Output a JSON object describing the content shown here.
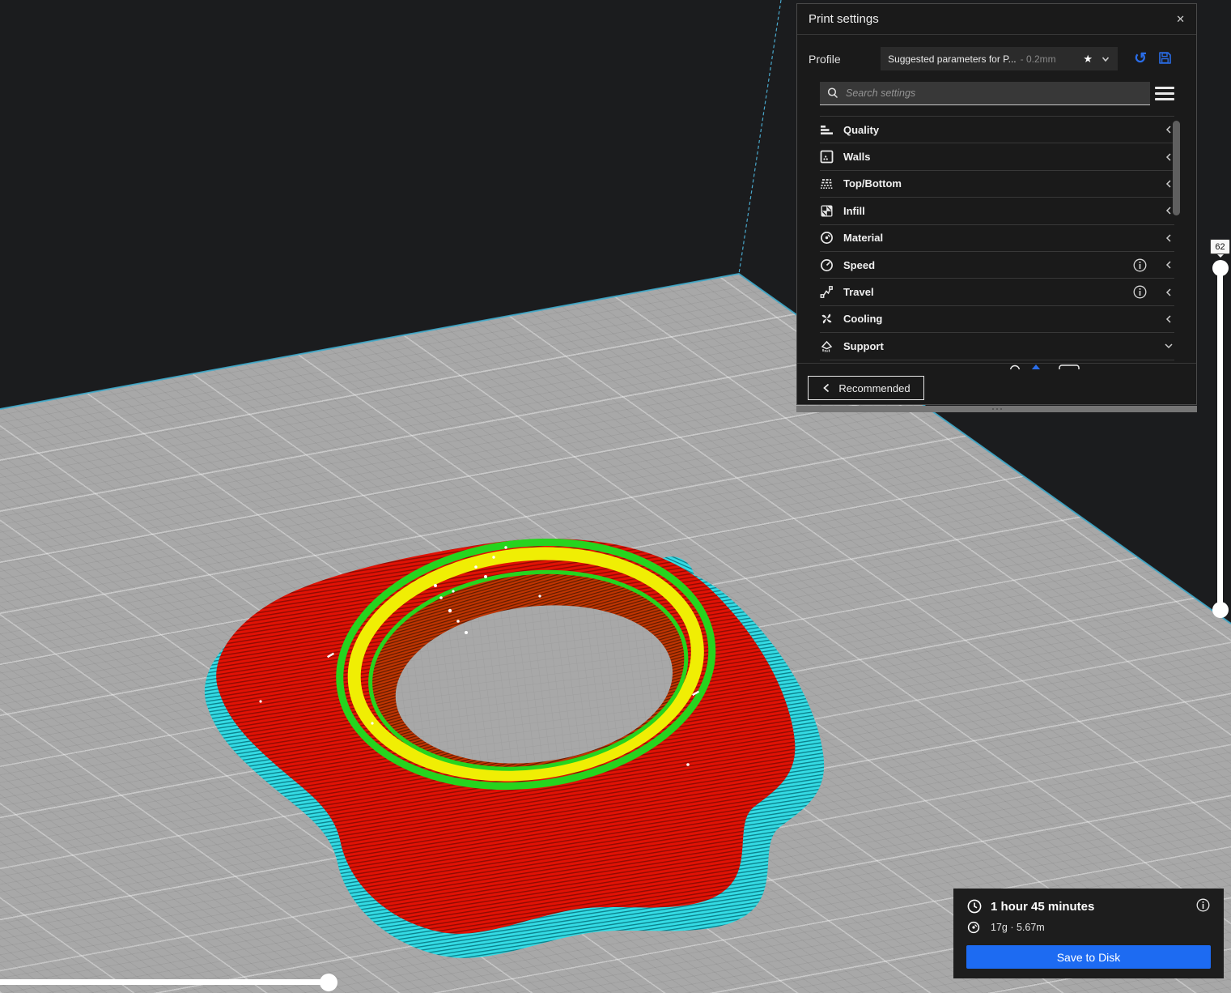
{
  "panel": {
    "title": "Print settings",
    "profile_label": "Profile",
    "profile_value": "Suggested parameters for P...",
    "profile_suffix": "- 0.2mm",
    "search_placeholder": "Search settings",
    "categories": [
      {
        "label": "Quality"
      },
      {
        "label": "Walls"
      },
      {
        "label": "Top/Bottom"
      },
      {
        "label": "Infill"
      },
      {
        "label": "Material"
      },
      {
        "label": "Speed",
        "info": true
      },
      {
        "label": "Travel",
        "info": true
      },
      {
        "label": "Cooling"
      },
      {
        "label": "Support",
        "expanded": true
      }
    ],
    "recommended_label": "Recommended"
  },
  "layer_slider": {
    "value": "62"
  },
  "summary": {
    "print_time": "1 hour 45 minutes",
    "material_usage": "17g · 5.67m",
    "save_button": "Save to Disk"
  },
  "icons": {
    "close": "✕",
    "star": "★",
    "undo": "↺"
  },
  "colors": {
    "accent_blue": "#1d6bf2",
    "icon_blue": "#2a6de8",
    "model_red": "#e11205",
    "model_cyan": "#30d8e2",
    "model_green": "#26d41e",
    "model_yellow": "#f0ee04",
    "plate_gray": "#a8a8a8",
    "volume_edge": "#3fa9c9"
  }
}
